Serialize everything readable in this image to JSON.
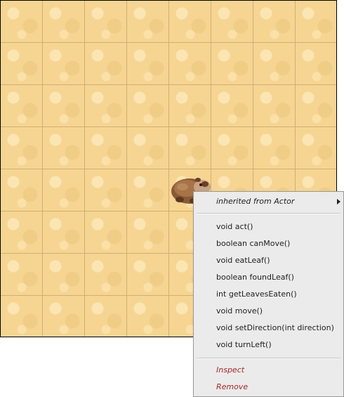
{
  "menu": {
    "inherited_label": "inherited from Actor",
    "methods": [
      "void act()",
      "boolean canMove()",
      "void eatLeaf()",
      "boolean foundLeaf()",
      "int getLeavesEaten()",
      "void move()",
      "void setDirection(int direction)",
      "void turnLeft()"
    ],
    "inspect_label": "Inspect",
    "remove_label": "Remove"
  },
  "icons": {
    "actor": "wombat-icon",
    "submenu": "chevron-right-icon"
  },
  "colors": {
    "world_background": "#f6d593",
    "grid_line": "#cfae73",
    "menu_background": "#ebebeb",
    "action_text": "#a52a2a"
  }
}
